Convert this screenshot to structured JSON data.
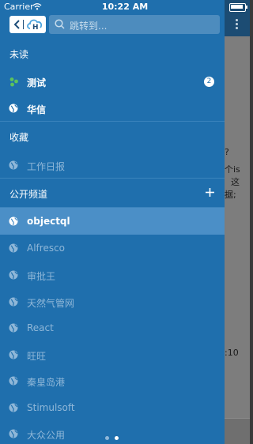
{
  "status_bar": {
    "carrier": "Carrier",
    "time": "10:22 AM"
  },
  "header": {
    "search_placeholder": "跳转到..."
  },
  "sections": {
    "unread": "未读",
    "favorites": "收藏",
    "public_channels": "公开频道"
  },
  "unread_items": [
    {
      "label": "测试",
      "badge": "2"
    },
    {
      "label": "华信"
    }
  ],
  "favorite_items": [
    {
      "label": "工作日报"
    }
  ],
  "channel_items": [
    {
      "label": "objectql"
    },
    {
      "label": "Alfresco"
    },
    {
      "label": "审批王"
    },
    {
      "label": "天然气管网"
    },
    {
      "label": "React"
    },
    {
      "label": "旺旺"
    },
    {
      "label": "秦皇岛港"
    },
    {
      "label": "Stimulsoft"
    },
    {
      "label": "大众公用"
    }
  ],
  "background_snippets": [
    {
      "text": "?"
    },
    {
      "text": "个is"
    },
    {
      "text": "这"
    },
    {
      "text": "据;"
    },
    {
      "text": ":10"
    }
  ],
  "colors": {
    "drawer_bg": "#1f6fad",
    "active_row": "#4b8fc7",
    "dim_text": "#8fb7d8",
    "presence_green": "#5cc35c"
  },
  "page_indicator": {
    "pages": 2,
    "current": 2
  }
}
